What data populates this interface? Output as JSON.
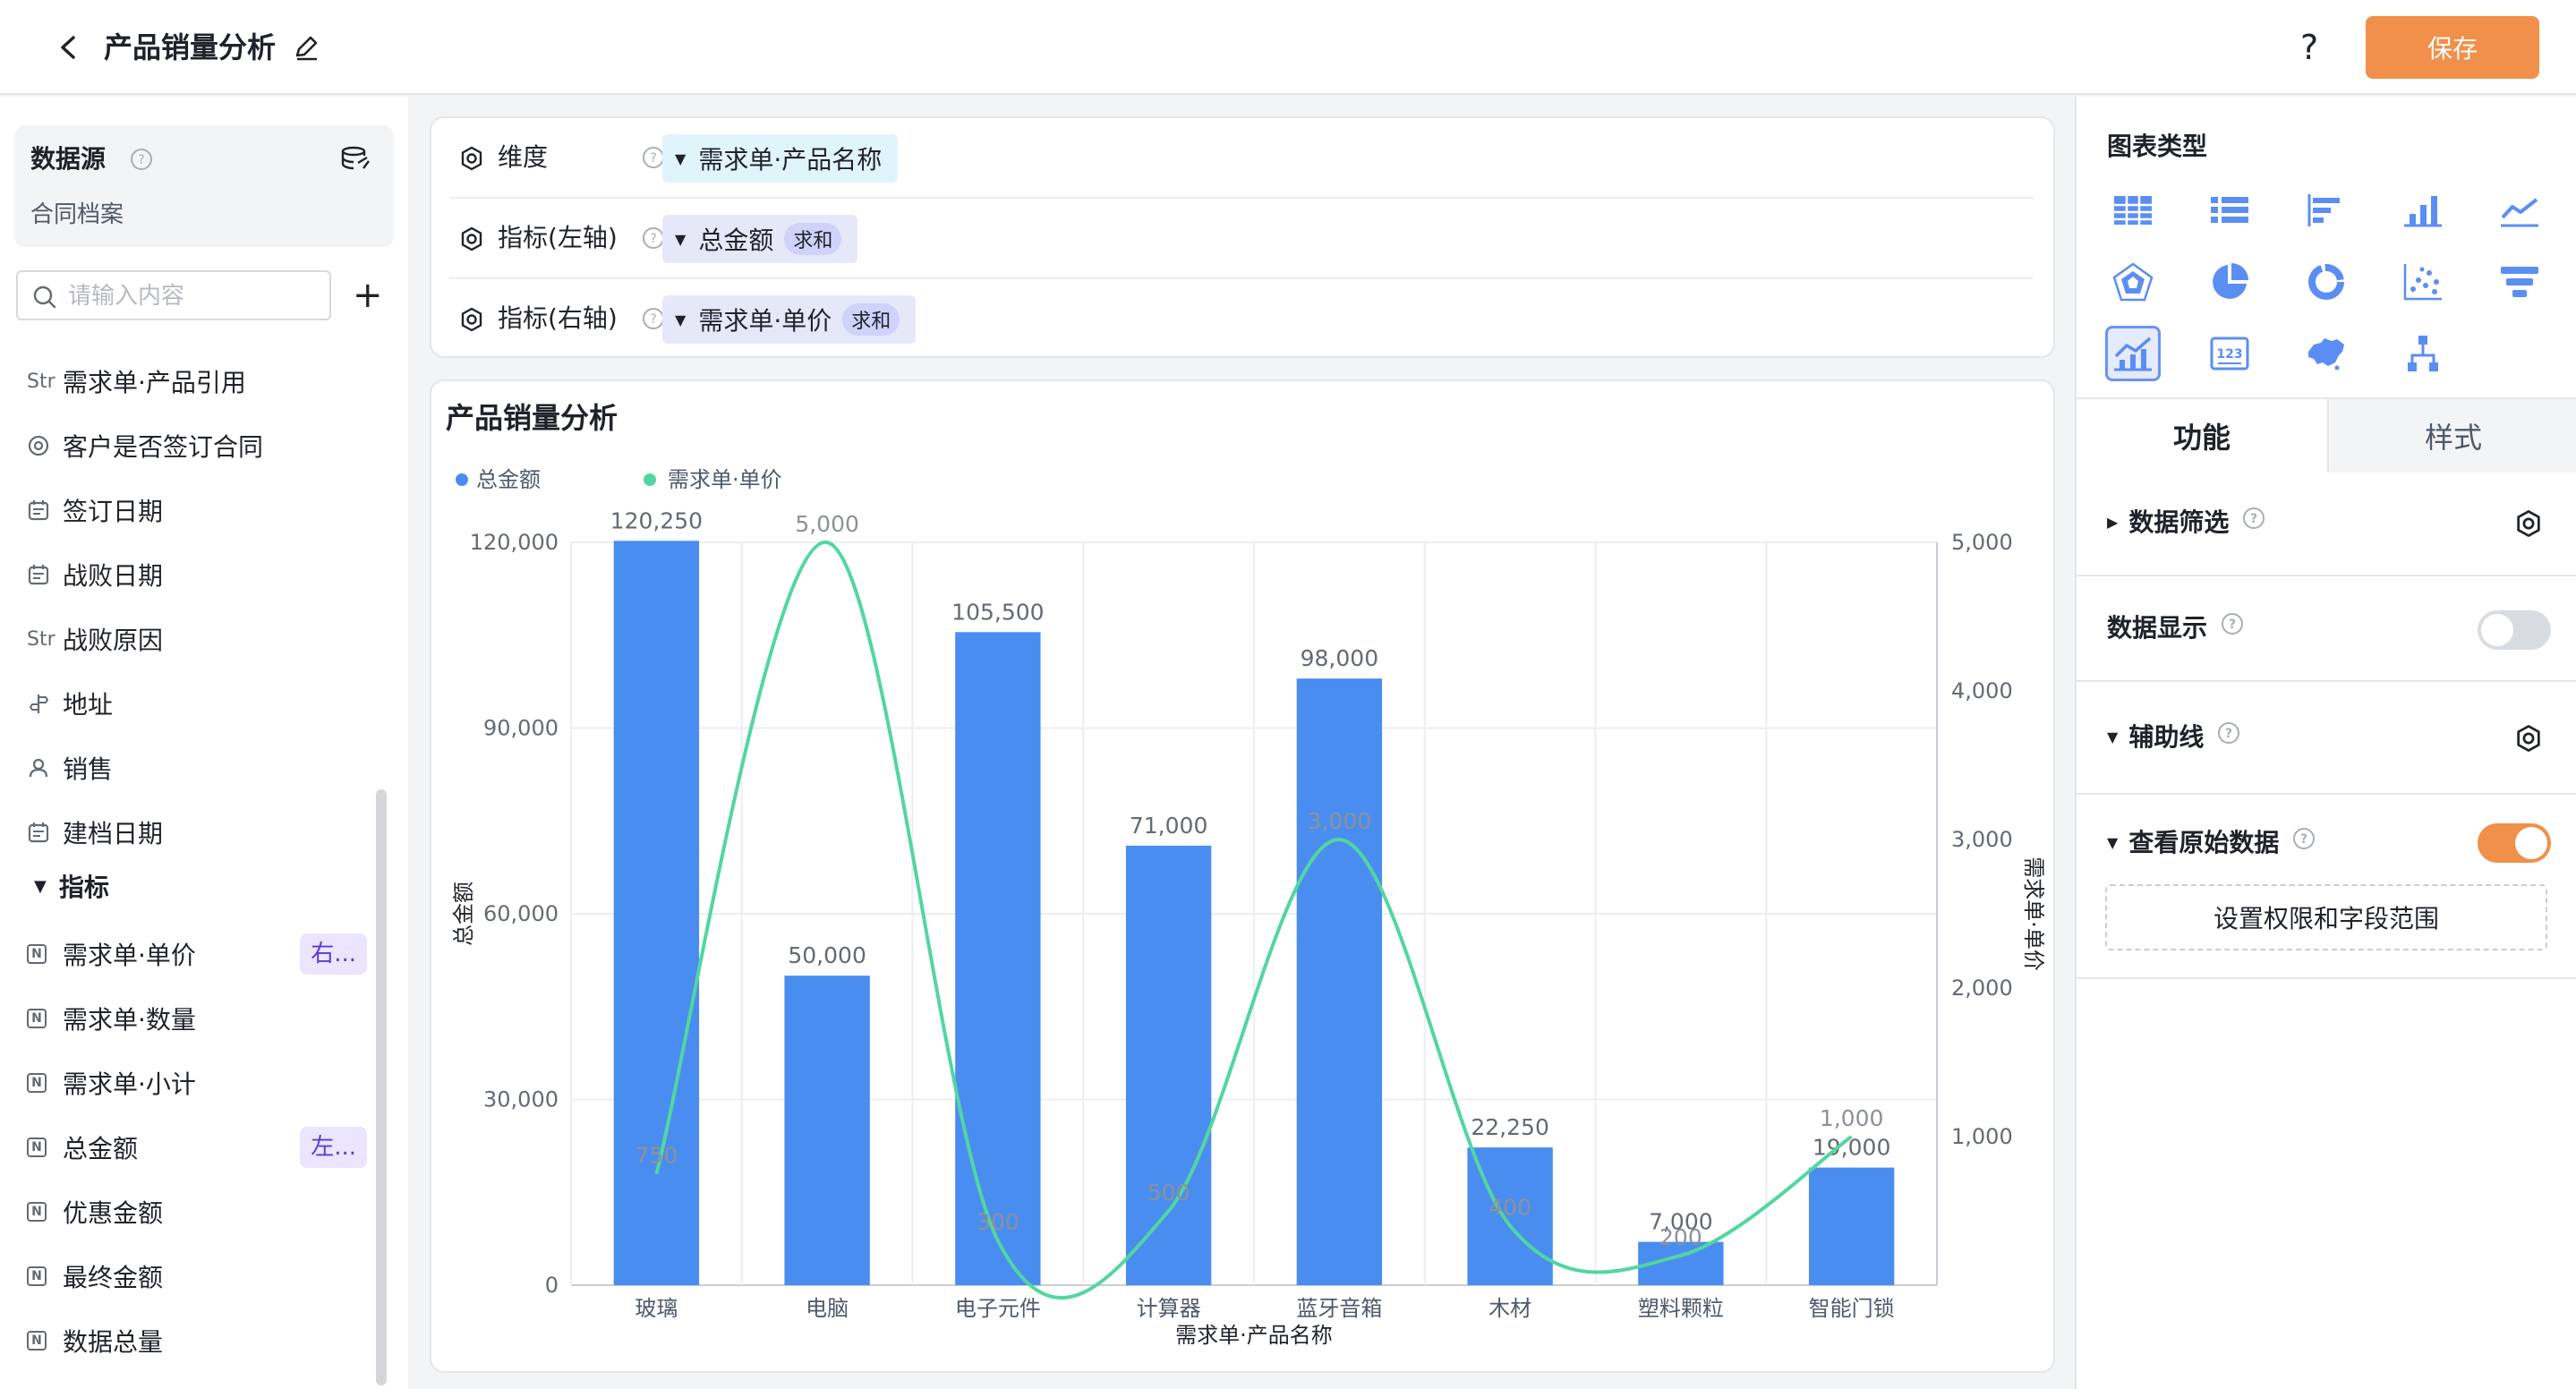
{
  "header": {
    "title": "产品销量分析",
    "save_label": "保存",
    "help_label": "?"
  },
  "sidebar": {
    "datasource_title": "数据源",
    "datasource_name": "合同档案",
    "search_placeholder": "请输入内容",
    "add_label": "+",
    "dimension_fields": [
      {
        "type": "Str",
        "label": "需求单·产品引用"
      },
      {
        "type": "option",
        "label": "客户是否签订合同"
      },
      {
        "type": "date",
        "label": "签订日期"
      },
      {
        "type": "date",
        "label": "战败日期"
      },
      {
        "type": "Str",
        "label": "战败原因"
      },
      {
        "type": "address",
        "label": "地址"
      },
      {
        "type": "user",
        "label": "销售"
      },
      {
        "type": "date",
        "label": "建档日期"
      }
    ],
    "metrics_group_label": "指标",
    "metric_fields": [
      {
        "label": "需求单·单价",
        "tag": "右..."
      },
      {
        "label": "需求单·数量",
        "tag": ""
      },
      {
        "label": "需求单·小计",
        "tag": ""
      },
      {
        "label": "总金额",
        "tag": "左..."
      },
      {
        "label": "优惠金额",
        "tag": ""
      },
      {
        "label": "最终金额",
        "tag": ""
      },
      {
        "label": "数据总量",
        "tag": ""
      }
    ]
  },
  "config": {
    "dimension_label": "维度",
    "dimension_value": "需求单·产品名称",
    "left_metric_label": "指标(左轴)",
    "left_metric_value": "总金额",
    "left_metric_agg": "求和",
    "right_metric_label": "指标(右轴)",
    "right_metric_value": "需求单·单价",
    "right_metric_agg": "求和"
  },
  "chart_title": "产品销量分析",
  "chart_data": {
    "type": "bar",
    "categories": [
      "玻璃",
      "电脑",
      "电子元件",
      "计算器",
      "蓝牙音箱",
      "木材",
      "塑料颗粒",
      "智能门锁"
    ],
    "series": [
      {
        "name": "总金额",
        "type": "bar",
        "axis": "left",
        "color": "#4a8df0",
        "values": [
          120250,
          50000,
          105500,
          71000,
          98000,
          22250,
          7000,
          19000
        ],
        "labels": [
          "120,250",
          "50,000",
          "105,500",
          "71,000",
          "98,000",
          "22,250",
          "7,000",
          "19,000"
        ]
      },
      {
        "name": "需求单·单价",
        "type": "line",
        "axis": "right",
        "color": "#52d6a0",
        "values": [
          750,
          5000,
          300,
          500,
          3000,
          400,
          200,
          1000
        ],
        "labels": [
          "750",
          "5,000",
          "300",
          "500",
          "3,000",
          "400",
          "200",
          "1,000"
        ]
      }
    ],
    "xlabel": "需求单·产品名称",
    "ylabel_left": "总金额",
    "ylabel_right": "需求单·单价",
    "ylim_left": [
      0,
      120000
    ],
    "ylim_right": [
      0,
      5000
    ],
    "yticks_left": [
      "0",
      "30,000",
      "60,000",
      "90,000",
      "120,000"
    ],
    "yticks_right": [
      "1,000",
      "2,000",
      "3,000",
      "4,000",
      "5,000"
    ],
    "legend": "top-left",
    "grid": true
  },
  "right_panel": {
    "chart_type_title": "图表类型",
    "chart_types": [
      "table-icon",
      "list-icon",
      "bar-horizontal-icon",
      "bar-vertical-icon",
      "line-icon",
      "radar-icon",
      "pie-icon",
      "donut-icon",
      "scatter-icon",
      "funnel-icon",
      "combo-chart-icon",
      "number-card-icon",
      "map-icon",
      "tree-icon"
    ],
    "tab_function": "功能",
    "tab_style": "样式",
    "data_filter_label": "数据筛选",
    "data_display_label": "数据显示",
    "aux_line_label": "辅助线",
    "raw_data_label": "查看原始数据",
    "perm_button_label": "设置权限和字段范围"
  },
  "colors": {
    "accent": "#f0904a",
    "bar": "#4a8df0",
    "line": "#52d6a0",
    "tag_bg": "#ece5ff",
    "tag_text": "#5b3bd1"
  }
}
